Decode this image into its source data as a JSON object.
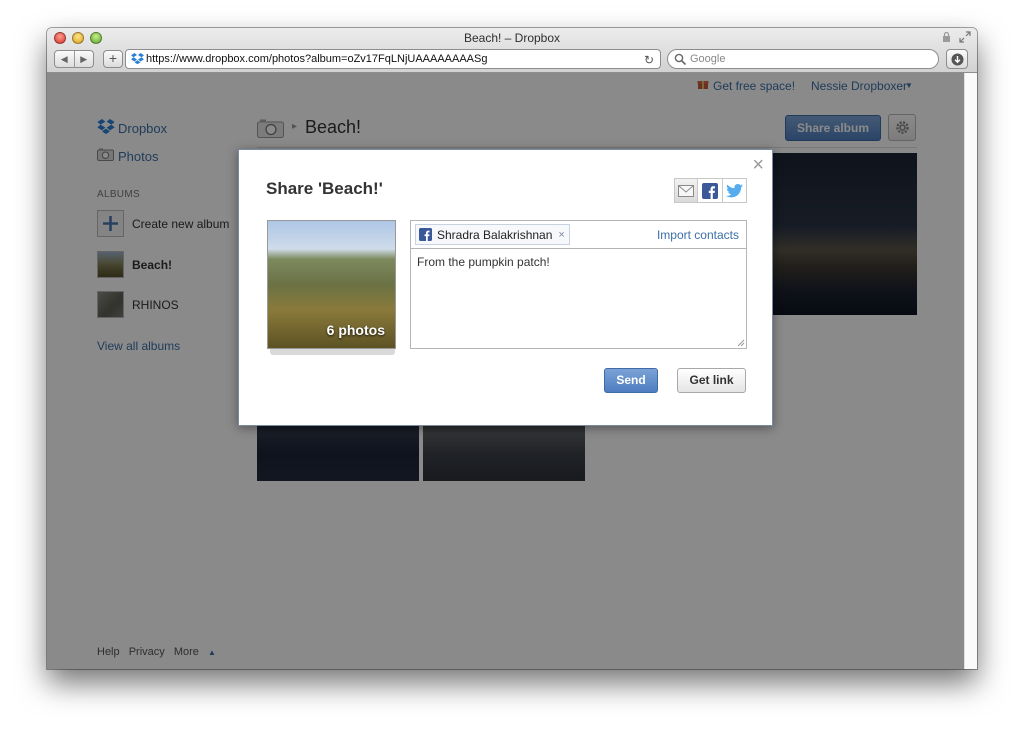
{
  "browser": {
    "window_title": "Beach! – Dropbox",
    "url": "https://www.dropbox.com/photos?album=oZv17FqLNjUAAAAAAAASg",
    "search_placeholder": "Google",
    "nav_back_icon": "back-arrow-icon",
    "nav_forward_icon": "forward-arrow-icon",
    "add_label": "+",
    "reload_glyph": "↻"
  },
  "topnav": {
    "free_space": "Get free space!",
    "user": "Nessie Dropboxer",
    "caret": "▼"
  },
  "sidebar": {
    "dropbox": "Dropbox",
    "photos": "Photos",
    "albums_heading": "ALBUMS",
    "albums": [
      {
        "label": "Create new album"
      },
      {
        "label": "Beach!"
      },
      {
        "label": "RHINOS"
      }
    ],
    "view_all": "View all albums"
  },
  "header": {
    "separator": "▸",
    "album_title": "Beach!",
    "share_album": "Share album"
  },
  "footer": {
    "help": "Help",
    "privacy": "Privacy",
    "more": "More",
    "caret": "▲"
  },
  "modal": {
    "title": "Share 'Beach!'",
    "close": "×",
    "photo_count": "6 photos",
    "recipient": "Shradra Balakrishnan",
    "recipient_remove": "×",
    "import_contacts": "Import contacts",
    "message": "From the pumpkin patch!",
    "send": "Send",
    "get_link": "Get link"
  },
  "colors": {
    "link": "#3d6fa8",
    "primary_button": "#5a86c4",
    "overlay": "rgba(0,0,0,0.46)",
    "facebook": "#3b5998",
    "twitter": "#55acee"
  }
}
